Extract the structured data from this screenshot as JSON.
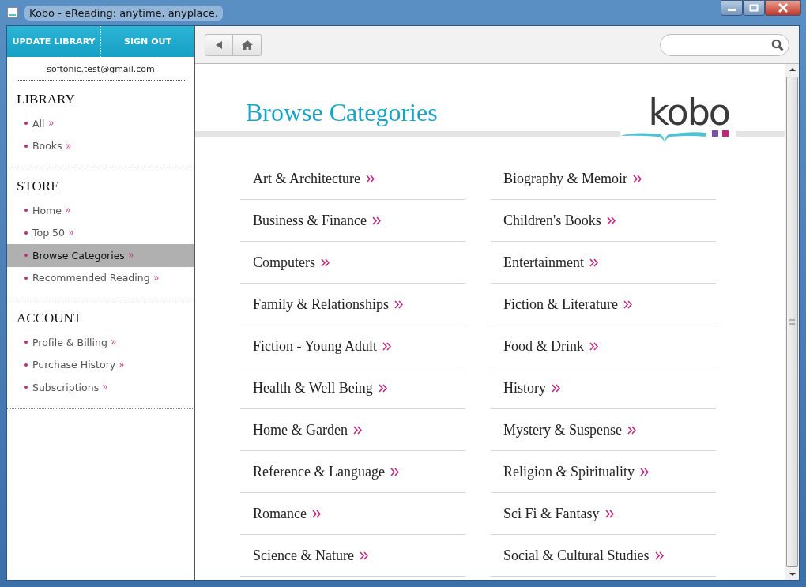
{
  "window": {
    "title": "Kobo - eReading: anytime, anyplace."
  },
  "sidebar": {
    "actions": [
      "UPDATE LIBRARY",
      "SIGN OUT"
    ],
    "email": "softonic.test@gmail.com",
    "sections": [
      {
        "heading": "LIBRARY",
        "items": [
          {
            "label": "All",
            "selected": false
          },
          {
            "label": "Books",
            "selected": false
          }
        ]
      },
      {
        "heading": "STORE",
        "items": [
          {
            "label": "Home",
            "selected": false
          },
          {
            "label": "Top 50",
            "selected": false
          },
          {
            "label": "Browse Categories",
            "selected": true
          },
          {
            "label": "Recommended Reading",
            "selected": false
          }
        ]
      },
      {
        "heading": "ACCOUNT",
        "items": [
          {
            "label": "Profile & Billing",
            "selected": false
          },
          {
            "label": "Purchase History",
            "selected": false
          },
          {
            "label": "Subscriptions",
            "selected": false
          }
        ]
      }
    ]
  },
  "page": {
    "title": "Browse Categories",
    "logo": "kobo",
    "categories": [
      "Art & Architecture",
      "Biography & Memoir",
      "Business & Finance",
      "Children's Books",
      "Computers",
      "Entertainment",
      "Family & Relationships",
      "Fiction & Literature",
      "Fiction - Young Adult",
      "Food & Drink",
      "Health & Well Being",
      "History",
      "Home & Garden",
      "Mystery & Suspense",
      "Reference & Language",
      "Religion & Spirituality",
      "Romance",
      "Sci Fi & Fantasy",
      "Science & Nature",
      "Social & Cultural Studies"
    ]
  }
}
